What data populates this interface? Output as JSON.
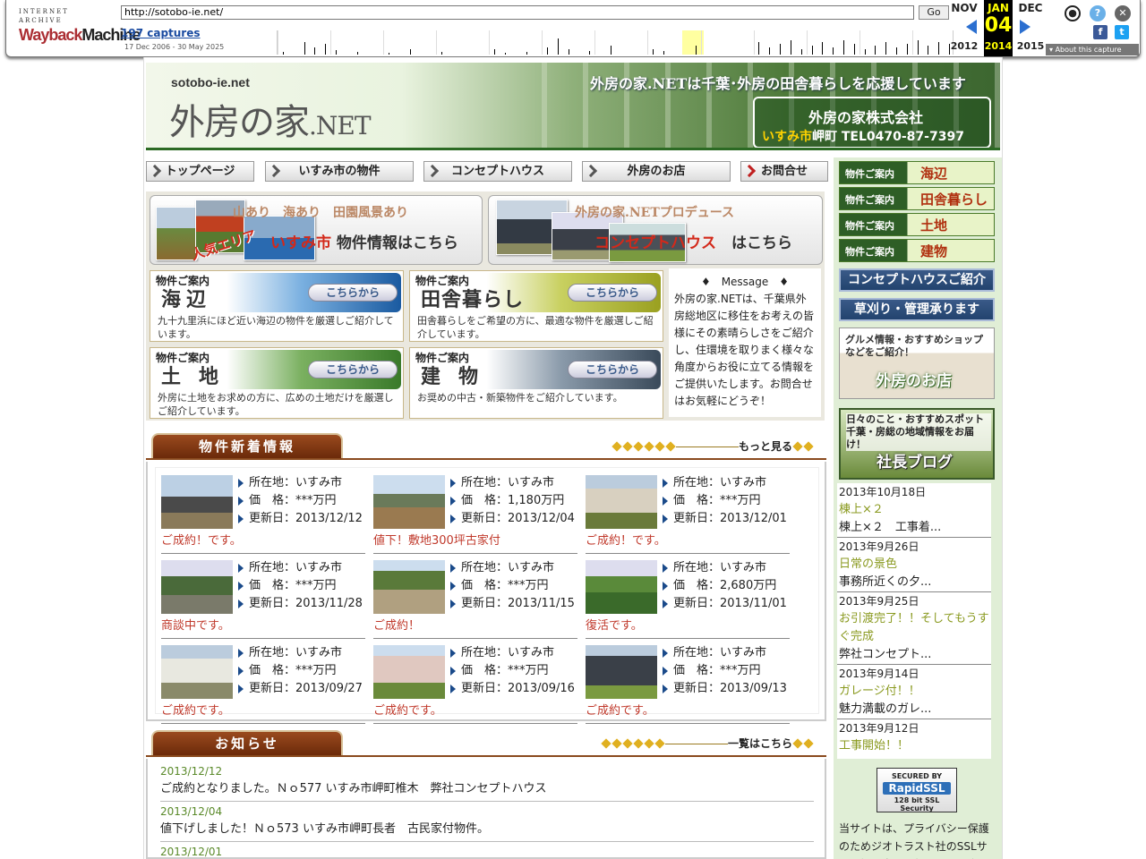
{
  "wayback": {
    "logo_top": "INTERNET ARCHIVE",
    "logo_main_a": "Wayback",
    "logo_main_b": "Machine",
    "url": "http://sotobo-ie.net/",
    "go": "Go",
    "captures": "197 captures",
    "range": "17 Dec 2006 - 30 May 2025",
    "prev_month": "NOV",
    "prev_year": "2012",
    "cur_month": "JAN",
    "cur_day": "04",
    "cur_year": "2014",
    "next_month": "DEC",
    "next_year": "2015",
    "about": "About this capture",
    "icons": [
      "account-icon",
      "help-icon",
      "close-icon",
      "facebook-icon",
      "twitter-icon"
    ],
    "spark": [
      3,
      0,
      14,
      8,
      12,
      5,
      0,
      3,
      0,
      0,
      2,
      0,
      6,
      0,
      0,
      3,
      0,
      0,
      0,
      0,
      6,
      2,
      0,
      3,
      0,
      8,
      18,
      6,
      0,
      4,
      0,
      10,
      0,
      0,
      0,
      6,
      4,
      0,
      0,
      10,
      0,
      0,
      0,
      0,
      0,
      14,
      8,
      12,
      16,
      6,
      10,
      14,
      8,
      16,
      12,
      6,
      10,
      14,
      8,
      12,
      16,
      10,
      14,
      12
    ]
  },
  "header": {
    "domain": "sotobo-ie.net",
    "logo_main": "外房の家",
    "logo_net": ".NET",
    "tagline": "外房の家.NETは千葉･外房の田舎暮らしを応援しています",
    "company": "外房の家株式会社",
    "tel_city": "いすみ市",
    "tel_rest": "岬町 TEL0470-87-7397"
  },
  "nav": [
    "トップページ",
    "いすみ市の物件",
    "コンセプトハウス",
    "外房のお店",
    "お問合せ"
  ],
  "banners": {
    "isumi_top": "山あり　海あり　田園風景あり",
    "isumi_ninki": "人気エリア",
    "isumi_city": "いすみ市",
    "isumi_rest": "物件情報はこちら",
    "concept_top": "外房の家.NETプロデュース",
    "concept_main": "コンセプトハウス",
    "concept_rest": "はこちら"
  },
  "categories": [
    {
      "small": "物件ご案内",
      "big": "海辺",
      "btn": "こちらから",
      "desc": "九十九里浜にほど近い海辺の物件を厳選しご紹介しています。"
    },
    {
      "small": "物件ご案内",
      "big": "田舎暮らし",
      "btn": "こちらから",
      "desc": "田舎暮らしをご希望の方に、最適な物件を厳選しご紹介しています。"
    },
    {
      "small": "物件ご案内",
      "big": "土地",
      "btn": "こちらから",
      "desc": "外房に土地をお求めの方に、広めの土地だけを厳選しご紹介しています。"
    },
    {
      "small": "物件ご案内",
      "big": "建物",
      "btn": "こちらから",
      "desc": "お奨めの中古・新築物件をご紹介しています。"
    }
  ],
  "message": {
    "heading": "♦　Message　♦",
    "body": "外房の家.NETは、千葉県外房総地区に移住をお考えの皆様にその素晴らしさをご紹介し、住環境を取りまく様々な角度からお役に立てる情報をご提供いたします。お問合せはお気軽にどうぞ！"
  },
  "new_props": {
    "title": "物件新着情報",
    "more": "もっと見る",
    "items": [
      {
        "loc": "所在地：いすみ市",
        "price": "価　格：***万円",
        "upd": "更新日：2013/12/12",
        "note": "ご成約！です。"
      },
      {
        "loc": "所在地：いすみ市",
        "price": "価　格：1,180万円",
        "upd": "更新日：2013/12/04",
        "note": "値下！敷地300坪古家付"
      },
      {
        "loc": "所在地：いすみ市",
        "price": "価　格：***万円",
        "upd": "更新日：2013/12/01",
        "note": "ご成約！です。"
      },
      {
        "loc": "所在地：いすみ市",
        "price": "価　格：***万円",
        "upd": "更新日：2013/11/28",
        "note": "商談中です。"
      },
      {
        "loc": "所在地：いすみ市",
        "price": "価　格：***万円",
        "upd": "更新日：2013/11/15",
        "note": "ご成約！"
      },
      {
        "loc": "所在地：いすみ市",
        "price": "価　格：2,680万円",
        "upd": "更新日：2013/11/01",
        "note": "復活です。"
      },
      {
        "loc": "所在地：いすみ市",
        "price": "価　格：***万円",
        "upd": "更新日：2013/09/27",
        "note": "ご成約です。"
      },
      {
        "loc": "所在地：いすみ市",
        "price": "価　格：***万円",
        "upd": "更新日：2013/09/16",
        "note": "ご成約です。"
      },
      {
        "loc": "所在地：いすみ市",
        "price": "価　格：***万円",
        "upd": "更新日：2013/09/13",
        "note": "ご成約です。"
      }
    ]
  },
  "news": {
    "title": "お知らせ",
    "more": "一覧はこちら",
    "items": [
      {
        "date": "2013/12/12",
        "text": "ご成約となりました。Ｎｏ577 いすみ市岬町椎木　弊社コンセプトハウス"
      },
      {
        "date": "2013/12/04",
        "text": "値下げしました！Ｎｏ573 いすみ市岬町長者　古民家付物件。"
      },
      {
        "date": "2013/12/01",
        "text": ""
      }
    ]
  },
  "sidebar": {
    "props": [
      {
        "a": "物件ご案内",
        "b": "海辺"
      },
      {
        "a": "物件ご案内",
        "b": "田舎暮らし"
      },
      {
        "a": "物件ご案内",
        "b": "土地"
      },
      {
        "a": "物件ご案内",
        "b": "建物"
      }
    ],
    "concept": "コンセプトハウスご紹介",
    "mowing": "草刈り・管理承ります",
    "shop_sub": "グルメ情報・おすすめショップなどをご紹介！",
    "shop_main": "外房のお店",
    "blog_sub": "日々のこと・おすすめスポット千葉・房総の地域情報をお届け！",
    "blog_main": "社長ブログ",
    "blog": [
      {
        "date": "2013年10月18日",
        "title": "棟上×２",
        "text": "棟上×２　工事着..."
      },
      {
        "date": "2013年9月26日",
        "title": "日常の景色",
        "text": "事務所近くの夕..."
      },
      {
        "date": "2013年9月25日",
        "title": "お引渡完了！！そしてもうすぐ完成",
        "text": "弊社コンセプト..."
      },
      {
        "date": "2013年9月14日",
        "title": "ガレージ付！！",
        "text": "魅力満載のガレ..."
      },
      {
        "date": "2013年9月12日",
        "title": "工事開始！！",
        "text": "..."
      }
    ],
    "ssl_a": "SECURED BY",
    "ssl_b": "RapidSSL",
    "ssl_c": "128 bit SSL Security",
    "ssl_text": "当サイトは、プライバシー保護のためジオトラスト社のSSLサーバ証明書を取得し、SSL暗号化通信を"
  }
}
